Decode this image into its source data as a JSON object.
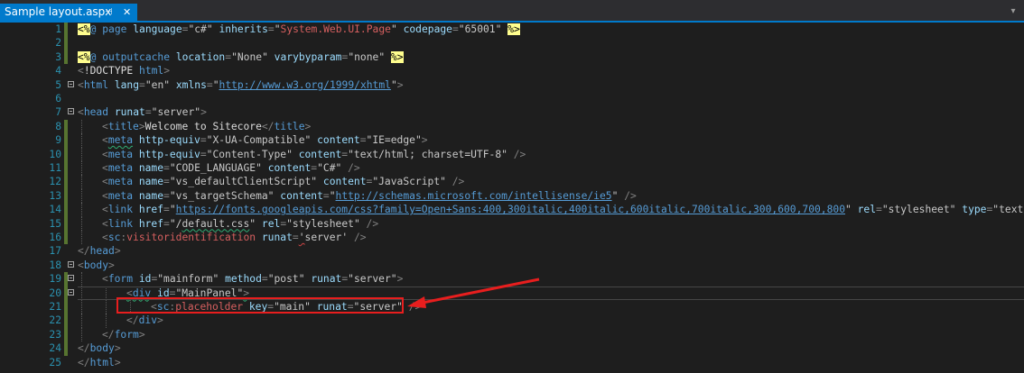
{
  "tab": {
    "title": "Sample layout.aspx",
    "pin_icon": "pin-icon",
    "close_icon": "close-icon",
    "close_glyph": "✕",
    "pin_glyph": "⊣"
  },
  "colors": {
    "accent": "#007acc",
    "background": "#1e1e1e",
    "line_number": "#2b91af",
    "annotation": "#e81e1e"
  },
  "lines": [
    {
      "n": "1",
      "chg": true,
      "fold": false,
      "guide": 0,
      "tokens": [
        [
          "delim",
          "<%"
        ],
        [
          "dir",
          "@ page "
        ],
        [
          "attr",
          "language"
        ],
        [
          "bracket",
          "="
        ],
        [
          "val",
          "\"c#\" "
        ],
        [
          "attr",
          "inherits"
        ],
        [
          "bracket",
          "="
        ],
        [
          "val",
          "\""
        ],
        [
          "red",
          "System.Web.UI.Page"
        ],
        [
          "val",
          "\" "
        ],
        [
          "attr",
          "codepage"
        ],
        [
          "bracket",
          "="
        ],
        [
          "val",
          "\"65001\" "
        ],
        [
          "delim",
          "%>"
        ]
      ]
    },
    {
      "n": "2",
      "chg": true,
      "fold": false,
      "guide": 0,
      "tokens": []
    },
    {
      "n": "3",
      "chg": true,
      "fold": false,
      "guide": 0,
      "tokens": [
        [
          "delim",
          "<%"
        ],
        [
          "dir",
          "@ outputcache "
        ],
        [
          "attr",
          "location"
        ],
        [
          "bracket",
          "="
        ],
        [
          "val",
          "\"None\" "
        ],
        [
          "attr",
          "varybyparam"
        ],
        [
          "bracket",
          "="
        ],
        [
          "val",
          "\"none\" "
        ],
        [
          "delim",
          "%>"
        ]
      ]
    },
    {
      "n": "4",
      "chg": false,
      "fold": false,
      "guide": 0,
      "tokens": [
        [
          "bracket",
          "<"
        ],
        [
          "pre",
          "!DOCTYPE "
        ],
        [
          "tag",
          "html"
        ],
        [
          "bracket",
          ">"
        ]
      ]
    },
    {
      "n": "5",
      "chg": false,
      "fold": true,
      "guide": 0,
      "tokens": [
        [
          "bracket",
          "<"
        ],
        [
          "tag",
          "html "
        ],
        [
          "attr",
          "lang"
        ],
        [
          "bracket",
          "="
        ],
        [
          "val",
          "\"en\" "
        ],
        [
          "attr",
          "xmlns"
        ],
        [
          "bracket",
          "="
        ],
        [
          "val",
          "\""
        ],
        [
          "link",
          "http://www.w3.org/1999/xhtml"
        ],
        [
          "val",
          "\""
        ],
        [
          "bracket",
          ">"
        ]
      ]
    },
    {
      "n": "6",
      "chg": false,
      "fold": false,
      "guide": 0,
      "tokens": []
    },
    {
      "n": "7",
      "chg": false,
      "fold": true,
      "guide": 0,
      "tokens": [
        [
          "bracket",
          "<"
        ],
        [
          "tag",
          "head "
        ],
        [
          "attr",
          "runat"
        ],
        [
          "bracket",
          "="
        ],
        [
          "val",
          "\"server\""
        ],
        [
          "bracket",
          ">"
        ]
      ]
    },
    {
      "n": "8",
      "chg": true,
      "fold": false,
      "guide": 1,
      "tokens": [
        [
          "bracket",
          "<"
        ],
        [
          "tag",
          "title"
        ],
        [
          "bracket",
          ">"
        ],
        [
          "text",
          "Welcome to Sitecore"
        ],
        [
          "bracket",
          "</"
        ],
        [
          "tag",
          "title"
        ],
        [
          "bracket",
          ">"
        ]
      ]
    },
    {
      "n": "9",
      "chg": true,
      "fold": false,
      "guide": 1,
      "tokens": [
        [
          "bracket",
          "<"
        ],
        [
          "tagsq",
          "meta"
        ],
        [
          "tag",
          " "
        ],
        [
          "attr",
          "http-equiv"
        ],
        [
          "bracket",
          "="
        ],
        [
          "val",
          "\"X-UA-Compatible\" "
        ],
        [
          "attr",
          "content"
        ],
        [
          "bracket",
          "="
        ],
        [
          "val",
          "\"IE=edge\""
        ],
        [
          "bracket",
          ">"
        ]
      ]
    },
    {
      "n": "10",
      "chg": true,
      "fold": false,
      "guide": 1,
      "tokens": [
        [
          "bracket",
          "<"
        ],
        [
          "tag",
          "meta "
        ],
        [
          "attr",
          "http-equiv"
        ],
        [
          "bracket",
          "="
        ],
        [
          "val",
          "\"Content-Type\" "
        ],
        [
          "attr",
          "content"
        ],
        [
          "bracket",
          "="
        ],
        [
          "val",
          "\"text/html; charset=UTF-8\" "
        ],
        [
          "bracket",
          "/>"
        ]
      ]
    },
    {
      "n": "11",
      "chg": true,
      "fold": false,
      "guide": 1,
      "tokens": [
        [
          "bracket",
          "<"
        ],
        [
          "tag",
          "meta "
        ],
        [
          "attr",
          "name"
        ],
        [
          "bracket",
          "="
        ],
        [
          "val",
          "\"CODE_LANGUAGE\" "
        ],
        [
          "attr",
          "content"
        ],
        [
          "bracket",
          "="
        ],
        [
          "val",
          "\"C#\" "
        ],
        [
          "bracket",
          "/>"
        ]
      ]
    },
    {
      "n": "12",
      "chg": true,
      "fold": false,
      "guide": 1,
      "tokens": [
        [
          "bracket",
          "<"
        ],
        [
          "tag",
          "meta "
        ],
        [
          "attr",
          "name"
        ],
        [
          "bracket",
          "="
        ],
        [
          "val",
          "\"vs_defaultClientScript\" "
        ],
        [
          "attr",
          "content"
        ],
        [
          "bracket",
          "="
        ],
        [
          "val",
          "\"JavaScript\" "
        ],
        [
          "bracket",
          "/>"
        ]
      ]
    },
    {
      "n": "13",
      "chg": true,
      "fold": false,
      "guide": 1,
      "tokens": [
        [
          "bracket",
          "<"
        ],
        [
          "tag",
          "meta "
        ],
        [
          "attr",
          "name"
        ],
        [
          "bracket",
          "="
        ],
        [
          "val",
          "\"vs_targetSchema\" "
        ],
        [
          "attr",
          "content"
        ],
        [
          "bracket",
          "="
        ],
        [
          "val",
          "\""
        ],
        [
          "link",
          "http://schemas.microsoft.com/intellisense/ie5"
        ],
        [
          "val",
          "\" "
        ],
        [
          "bracket",
          "/>"
        ]
      ]
    },
    {
      "n": "14",
      "chg": true,
      "fold": false,
      "guide": 1,
      "tokens": [
        [
          "bracket",
          "<"
        ],
        [
          "tag",
          "link "
        ],
        [
          "attr",
          "href"
        ],
        [
          "bracket",
          "="
        ],
        [
          "val",
          "\""
        ],
        [
          "link",
          "https://fonts.googleapis.com/css?family=Open+Sans:400,300italic,400italic,600italic,700italic,300,600,700,800"
        ],
        [
          "val",
          "\" "
        ],
        [
          "attr",
          "rel"
        ],
        [
          "bracket",
          "="
        ],
        [
          "val",
          "\"stylesheet\" "
        ],
        [
          "attr",
          "type"
        ],
        [
          "bracket",
          "="
        ],
        [
          "val",
          "\"text/css\" "
        ],
        [
          "bracket",
          "/>"
        ]
      ]
    },
    {
      "n": "15",
      "chg": true,
      "fold": false,
      "guide": 1,
      "tokens": [
        [
          "bracket",
          "<"
        ],
        [
          "tag",
          "link "
        ],
        [
          "attr",
          "href"
        ],
        [
          "bracket",
          "="
        ],
        [
          "val",
          "\"/"
        ],
        [
          "valsq",
          "default.css"
        ],
        [
          "val",
          "\" "
        ],
        [
          "attr",
          "rel"
        ],
        [
          "bracket",
          "="
        ],
        [
          "val",
          "\"stylesheet\" "
        ],
        [
          "bracket",
          "/>"
        ]
      ]
    },
    {
      "n": "16",
      "chg": true,
      "fold": false,
      "guide": 1,
      "tokens": [
        [
          "bracket",
          "<"
        ],
        [
          "tag",
          "sc"
        ],
        [
          "bracket",
          ":"
        ],
        [
          "red",
          "visitoridentification "
        ],
        [
          "attr",
          "runat"
        ],
        [
          "bracket",
          "="
        ],
        [
          "valsq2",
          "'"
        ],
        [
          "val",
          "server' "
        ],
        [
          "bracket",
          "/>"
        ]
      ]
    },
    {
      "n": "17",
      "chg": false,
      "fold": false,
      "guide": 0,
      "tokens": [
        [
          "bracket",
          "</"
        ],
        [
          "tag",
          "head"
        ],
        [
          "bracket",
          ">"
        ]
      ]
    },
    {
      "n": "18",
      "chg": false,
      "fold": true,
      "guide": 0,
      "tokens": [
        [
          "bracket",
          "<"
        ],
        [
          "tag",
          "body"
        ],
        [
          "bracket",
          ">"
        ]
      ]
    },
    {
      "n": "19",
      "chg": true,
      "fold": true,
      "guide": 1,
      "tokens": [
        [
          "bracket",
          "<"
        ],
        [
          "tag",
          "form "
        ],
        [
          "attr",
          "id"
        ],
        [
          "bracket",
          "="
        ],
        [
          "val",
          "\"mainform\" "
        ],
        [
          "attr",
          "method"
        ],
        [
          "bracket",
          "="
        ],
        [
          "val",
          "\"post\" "
        ],
        [
          "attr",
          "runat"
        ],
        [
          "bracket",
          "="
        ],
        [
          "val",
          "\"server\""
        ],
        [
          "bracket",
          ">"
        ]
      ]
    },
    {
      "n": "20",
      "chg": true,
      "fold": true,
      "guide": 2,
      "current": true,
      "tokens": [
        [
          "bracketsq",
          "<"
        ],
        [
          "tagsq",
          "div"
        ],
        [
          "tag",
          " "
        ],
        [
          "attr",
          "id"
        ],
        [
          "bracket",
          "="
        ],
        [
          "val",
          "\"MainPanel\""
        ],
        [
          "bracketsq",
          ">"
        ]
      ]
    },
    {
      "n": "21",
      "chg": true,
      "fold": false,
      "guide": 3,
      "tokens": [
        [
          "bracket",
          "<"
        ],
        [
          "tag",
          "sc"
        ],
        [
          "bracket",
          ":"
        ],
        [
          "red",
          "placeholder "
        ],
        [
          "attr",
          "key"
        ],
        [
          "bracket",
          "="
        ],
        [
          "val",
          "\"main\" "
        ],
        [
          "attr",
          "runat"
        ],
        [
          "bracket",
          "="
        ],
        [
          "val",
          "\"server\" "
        ],
        [
          "bracket",
          "/>"
        ]
      ]
    },
    {
      "n": "22",
      "chg": true,
      "fold": false,
      "guide": 2,
      "tokens": [
        [
          "bracket",
          "</"
        ],
        [
          "tag",
          "div"
        ],
        [
          "bracket",
          ">"
        ]
      ]
    },
    {
      "n": "23",
      "chg": true,
      "fold": false,
      "guide": 1,
      "tokens": [
        [
          "bracket",
          "</"
        ],
        [
          "tag",
          "form"
        ],
        [
          "bracket",
          ">"
        ]
      ]
    },
    {
      "n": "24",
      "chg": true,
      "fold": false,
      "guide": 0,
      "tokens": [
        [
          "bracket",
          "</"
        ],
        [
          "tag",
          "body"
        ],
        [
          "bracket",
          ">"
        ]
      ]
    },
    {
      "n": "25",
      "chg": false,
      "fold": false,
      "guide": 0,
      "tokens": [
        [
          "bracket",
          "</"
        ],
        [
          "tag",
          "html"
        ],
        [
          "bracket",
          ">"
        ]
      ]
    }
  ]
}
